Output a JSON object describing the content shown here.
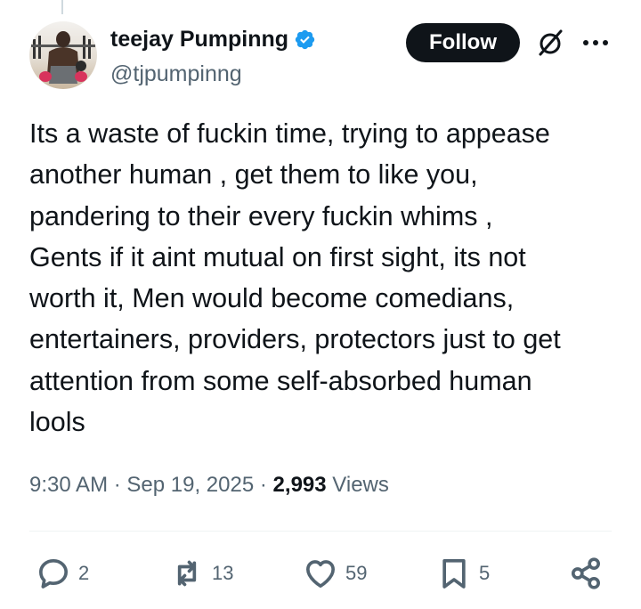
{
  "author": {
    "name": "teejay Pumpinng",
    "handle": "@tjpumpinng"
  },
  "header": {
    "follow_label": "Follow"
  },
  "icons": {
    "verified": "verified-badge-icon",
    "grok": "grok-icon",
    "more": "more-options-icon",
    "reply": "reply-icon",
    "repost": "repost-icon",
    "like": "like-icon",
    "bookmark": "bookmark-icon",
    "share": "share-icon"
  },
  "colors": {
    "text": "#0f1419",
    "secondary": "#536471",
    "verified": "#1d9bf0",
    "follow_bg": "#0f1419"
  },
  "tweet": {
    "text": "Its a waste of fuckin time, trying to appease\nanother human , get them to like you,\npandering to their every fuckin whims ,\nGents if it aint mutual on first sight, its not\nworth it, Men would become comedians,\nentertainers, providers, protectors just to get\nattention from some self-absorbed human\nlools",
    "time": "9:30 AM",
    "separator": "·",
    "date": "Sep 19, 2025",
    "views_count": "2,993",
    "views_label": "Views"
  },
  "actions": {
    "replies": "2",
    "reposts": "13",
    "likes": "59",
    "bookmarks": "5"
  }
}
